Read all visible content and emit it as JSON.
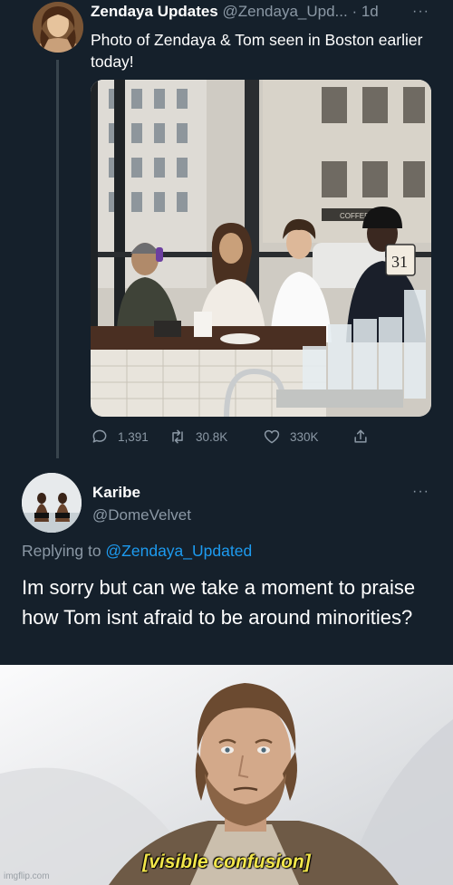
{
  "tweet_main": {
    "author_name": "Zendaya Updates",
    "handle": "@Zendaya_Upd...",
    "time": "· 1d",
    "more_label": "···",
    "text": "Photo of Zendaya & Tom seen in Boston earlier today!",
    "photo": {
      "cup_number": "31",
      "storefront_sign": "COFFEE"
    },
    "actions": {
      "replies": "1,391",
      "retweets": "30.8K",
      "likes": "330K"
    },
    "icons": [
      "reply-icon",
      "retweet-icon",
      "like-icon",
      "share-icon",
      "more-icon"
    ]
  },
  "tweet_reply": {
    "author_name": "Karibe",
    "handle": "@DomeVelvet",
    "more_label": "···",
    "replying_to_prefix": "Replying to ",
    "replying_to_handle": "@Zendaya_Updated",
    "text": "Im sorry but can we take a moment to praise how Tom isnt afraid to be around minorities?"
  },
  "meme": {
    "caption": "[visible confusion]",
    "watermark": "imgflip.com"
  },
  "colors": {
    "background": "#15202b",
    "secondary_text": "#8b98a5",
    "link": "#1d9bf0",
    "caption": "#f2e64a"
  }
}
